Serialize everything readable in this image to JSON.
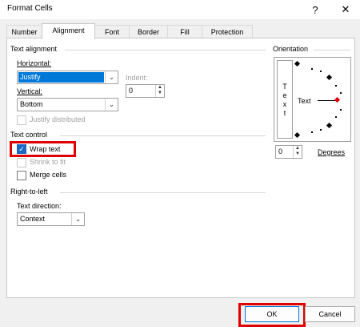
{
  "dialog": {
    "title": "Format Cells",
    "help_glyph": "?",
    "close_glyph": "✕"
  },
  "tabs": [
    {
      "label": "Number"
    },
    {
      "label": "Alignment"
    },
    {
      "label": "Font"
    },
    {
      "label": "Border"
    },
    {
      "label": "Fill"
    },
    {
      "label": "Protection"
    }
  ],
  "text_alignment": {
    "heading": "Text alignment",
    "horizontal_label": "Horizontal:",
    "horizontal_value": "Justify",
    "vertical_label": "Vertical:",
    "vertical_value": "Bottom",
    "indent_label": "Indent:",
    "indent_value": "0",
    "justify_distributed": "Justify distributed"
  },
  "text_control": {
    "heading": "Text control",
    "wrap_text": "Wrap text",
    "shrink_to_fit": "Shrink to fit",
    "merge_cells": "Merge cells"
  },
  "rtl": {
    "heading": "Right-to-left",
    "direction_label": "Text direction:",
    "direction_value": "Context"
  },
  "orientation": {
    "heading": "Orientation",
    "vertical_letters": [
      "T",
      "e",
      "x",
      "t"
    ],
    "text_sample": "Text",
    "degrees_value": "0",
    "degrees_label": "Degrees"
  },
  "buttons": {
    "ok": "OK",
    "cancel": "Cancel"
  },
  "colors": {
    "highlight": "#e00000",
    "selection": "#0078d7",
    "checkbox": "#1c68c4"
  }
}
